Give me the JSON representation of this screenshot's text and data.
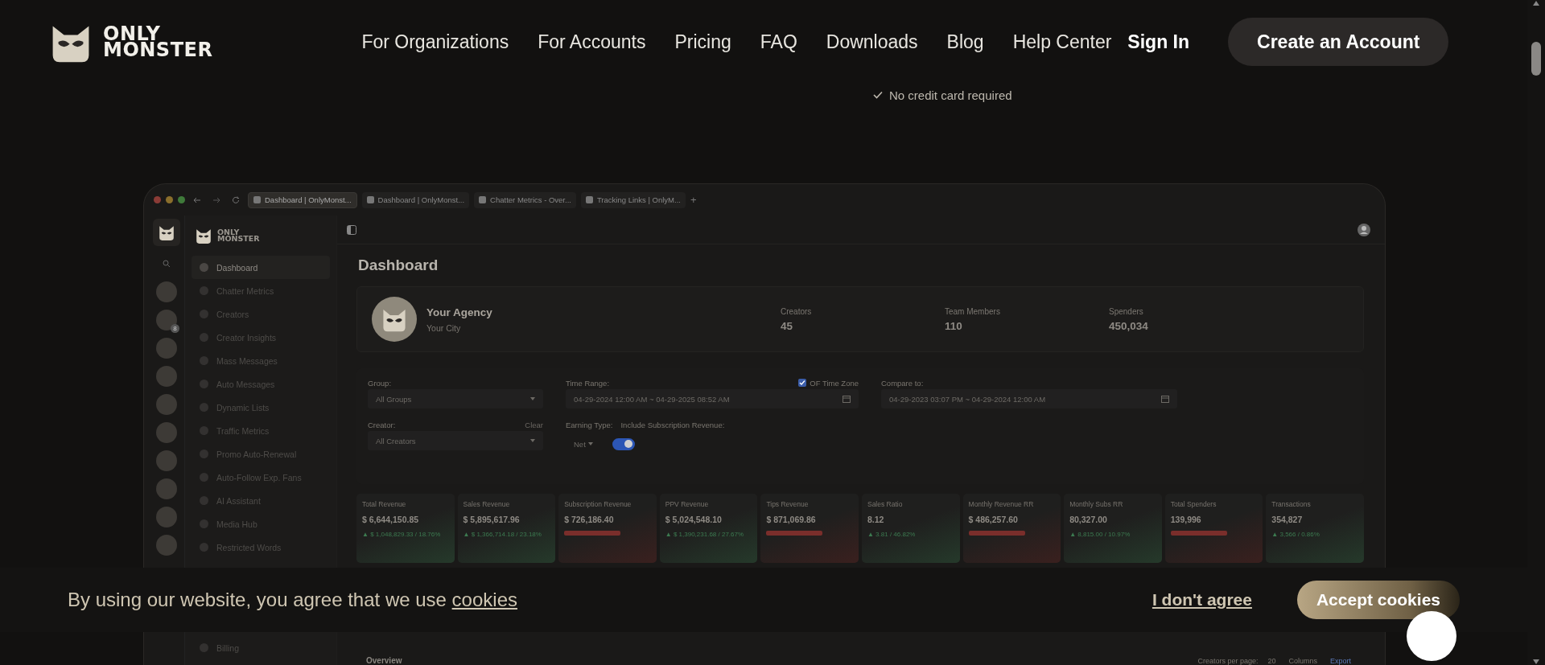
{
  "header": {
    "logo_text": [
      "ONLY",
      "MONSTER"
    ],
    "nav": [
      "For Organizations",
      "For Accounts",
      "Pricing",
      "FAQ",
      "Downloads",
      "Blog",
      "Help Center"
    ],
    "sign_in": "Sign In",
    "cta": "Create an Account",
    "note": "No credit card required"
  },
  "app": {
    "tabs": [
      {
        "label": "Dashboard | OnlyMonst...",
        "selected": true
      },
      {
        "label": "Dashboard | OnlyMonst...",
        "selected": false
      },
      {
        "label": "Chatter Metrics - Over...",
        "selected": false
      },
      {
        "label": "Tracking Links | OnlyM...",
        "selected": false
      }
    ],
    "new_tab": "+",
    "brand": [
      "ONLY",
      "MONSTER"
    ],
    "rail_badge": "8",
    "sidebar": [
      {
        "label": "Dashboard",
        "selected": true
      },
      {
        "label": "Chatter Metrics",
        "selected": false
      },
      {
        "label": "Creators",
        "selected": false
      },
      {
        "label": "Creator Insights",
        "selected": false
      },
      {
        "label": "Mass Messages",
        "selected": false
      },
      {
        "label": "Auto Messages",
        "selected": false
      },
      {
        "label": "Dynamic Lists",
        "selected": false
      },
      {
        "label": "Traffic Metrics",
        "selected": false
      },
      {
        "label": "Promo Auto-Renewal",
        "selected": false
      },
      {
        "label": "Auto-Follow Exp. Fans",
        "selected": false
      },
      {
        "label": "AI Assistant",
        "selected": false
      },
      {
        "label": "Media Hub",
        "selected": false
      },
      {
        "label": "Restricted Words",
        "selected": false
      }
    ],
    "sidebar_bottom": {
      "label": "Billing",
      "selected": false
    },
    "page_title": "Dashboard",
    "agency": {
      "name": "Your Agency",
      "city": "Your City",
      "stats": [
        {
          "label": "Creators",
          "value": "45"
        },
        {
          "label": "Team Members",
          "value": "110"
        },
        {
          "label": "Spenders",
          "value": "450,034"
        }
      ]
    },
    "filters": {
      "group": {
        "label": "Group:",
        "value": "All Groups"
      },
      "creator": {
        "label": "Creator:",
        "value": "All Creators",
        "clear": "Clear"
      },
      "time_range": {
        "label": "Time Range:",
        "value": "04-29-2024 12:00 AM ~ 04-29-2025 08:52 AM"
      },
      "of_time_zone": {
        "label": "OF Time Zone",
        "checked": true
      },
      "compare": {
        "label": "Compare to:",
        "value": "04-29-2023 03:07 PM ~ 04-29-2024 12:00 AM"
      },
      "earning_type": {
        "label": "Earning Type:",
        "value": "Net"
      },
      "include_sub": {
        "label": "Include Subscription Revenue:",
        "on": true
      }
    },
    "metrics": [
      {
        "label": "Total Revenue",
        "value": "$ 6,644,150.85",
        "color": "#3c7a50",
        "delta": "▲ $ 1,048,829.33 / 18.76%"
      },
      {
        "label": "Sales Revenue",
        "value": "$ 5,895,617.96",
        "color": "#3c7a50",
        "delta": "▲ $ 1,366,714.18 / 23.18%"
      },
      {
        "label": "Subscription Revenue",
        "value": "$ 726,186.40",
        "color": "#7a2e2b"
      },
      {
        "label": "PPV Revenue",
        "value": "$ 5,024,548.10",
        "color": "#3c7a50",
        "delta": "▲ $ 1,390,231.68 / 27.67%"
      },
      {
        "label": "Tips Revenue",
        "value": "$ 871,069.86",
        "color": "#7a2e2b"
      },
      {
        "label": "Sales Ratio",
        "value": "8.12",
        "color": "#3c7a50",
        "delta": "▲ 3.81 / 46.82%"
      },
      {
        "label": "Monthly Revenue RR",
        "value": "$ 486,257.60",
        "color": "#7a2e2b"
      },
      {
        "label": "Monthly Subs RR",
        "value": "80,327.00",
        "color": "#3c7a50",
        "delta": "▲ 8,815.00 / 10.97%"
      },
      {
        "label": "Total Spenders",
        "value": "139,996",
        "color": "#7a2e2b"
      },
      {
        "label": "Transactions",
        "value": "354,827",
        "color": "#3c7a50",
        "delta": "▲ 3,566 / 0.86%"
      }
    ],
    "overview": {
      "title": "Overview",
      "per_page_label": "Creators per page:",
      "per_page": "20",
      "columns": "Columns",
      "export": "Export"
    }
  },
  "cookie": {
    "text": "By using our website, you agree that we use ",
    "link": "cookies",
    "decline": "I don't agree",
    "accept": "Accept cookies"
  }
}
